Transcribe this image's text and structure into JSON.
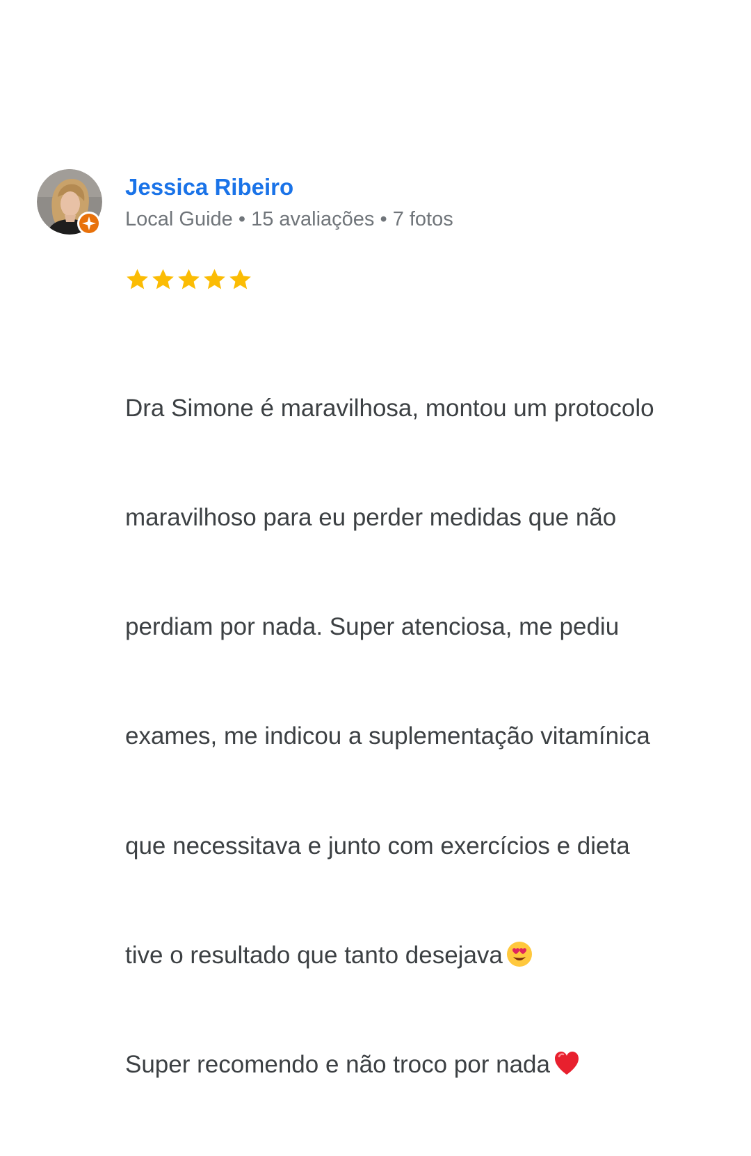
{
  "reviewer": {
    "name": "Jessica Ribeiro",
    "badge": "Local Guide",
    "separator": "•",
    "reviews_count": "15 avaliações",
    "photos_count": "7 fotos",
    "avatar_icon": "reviewer-avatar",
    "badge_icon": "local-guide-badge-icon"
  },
  "rating": {
    "stars": 5,
    "max_stars": 5,
    "star_color": "#fbbc04"
  },
  "review": {
    "lines": [
      "Dra Simone é maravilhosa, montou um protocolo",
      "maravilhoso para eu perder medidas que não",
      "perdiam por nada. Super atenciosa, me pediu",
      "exames, me indicou a suplementação vitamínica",
      "que necessitava e junto com exercícios e dieta",
      "tive o resultado que tanto desejava",
      "Super recomendo e não troco por nada"
    ],
    "emoji_after_line_6": "heart-eyes-emoji-icon",
    "emoji_after_line_7": "red-heart-emoji-icon"
  },
  "colors": {
    "name": "#1a73e8",
    "meta": "#70757a",
    "body_text": "#3c4043",
    "badge": "#e8710a"
  }
}
